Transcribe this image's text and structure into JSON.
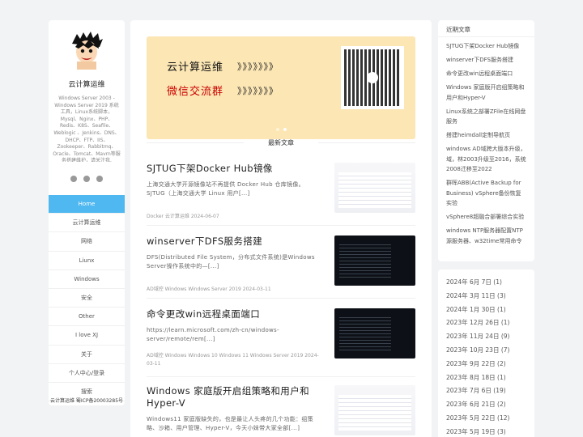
{
  "sidebar": {
    "site_name": "云计算运维",
    "site_desc": "Windows Server 2003 - Windows Server 2019 系统工具，Linux系统脚本，Mysql、Nginx、PHP、Redis、K8S、Seafile、Weblogic 、Jenkins、DNS、DHCP、FTP、IIS、Zookeeper、Rabbitmq、Oracle、Tomcat、Mavrn等服务搭建维护，请关注我.",
    "nav": [
      "Home",
      "云计算运维",
      "网络",
      "Liunx",
      "Windows",
      "安全",
      "Other",
      "I love XJ",
      "关于",
      "个人中心/登录",
      "搜索"
    ],
    "footer": "云计算运维 蜀ICP备20003285号"
  },
  "banner": {
    "line1": "云计算运维",
    "line2": "微信交流群",
    "arrows": "》》》》》》》"
  },
  "main": {
    "section_title": "最新文章",
    "posts": [
      {
        "title": "SJTUG下架Docker Hub镜像",
        "summary": "上海交通大学开源镜像站不再提供 Docker Hub 仓库镜像。SJTUG（上海交通大学 Linux 用户[...]",
        "meta": "Docker 云计算运维 2024-06-07"
      },
      {
        "title": "winserver下DFS服务搭建",
        "summary": "DFS(Distributed File System，分布式文件系统)是Windows Server操作系统中的—[...]",
        "meta": "AD域控 Windows Windows Server 2019 2024-03-11"
      },
      {
        "title": "命令更改win远程桌面端口",
        "summary": "https://learn.microsoft.com/zh-cn/windows-server/remote/rem[...]",
        "meta": "AD域控 Windows Windows 10 Windows 11 Windows Server 2019 2024-03-11"
      },
      {
        "title": "Windows 家庭版开启组策略和用户和Hyper-V",
        "summary": "Windows11 家庭版缺失的，也是最让人头疼的几个功能：组策略、沙箱、用户管理、Hyper-V，今天小妹带大家全部[...]",
        "meta": ""
      }
    ]
  },
  "recent": {
    "title": "近期文章",
    "items": [
      "SJTUG下架Docker Hub镜像",
      "winserver下DFS服务搭建",
      "命令更改win远程桌面端口",
      "Windows 家庭版开启组策略和用户和Hyper-V",
      "Linux系统之部署ZFile在线网盘服务",
      "搭建heimdall定制导航页",
      "windows AD域跨大版本升级，域，林2003升级至2016，系统2008迁移至2022",
      "群晖ABB(Active Backup for Business) vSphere备份恢复实验",
      "vSphere8超融合部署综合实验",
      "windows NTP服务器配置NTP源服务器、w32time常用命令"
    ]
  },
  "archives": [
    "2024年 6月 7日 (1)",
    "2024年 3月 11日 (3)",
    "2024年 1月 30日 (1)",
    "2023年 12月 26日 (1)",
    "2023年 11月 24日 (9)",
    "2023年 10月 23日 (7)",
    "2023年 9月 22日 (2)",
    "2023年 8月 18日 (1)",
    "2023年 7月 6日 (19)",
    "2023年 6月 21日 (2)",
    "2023年 5月 22日 (12)",
    "2023年 5月 19日 (3)"
  ]
}
